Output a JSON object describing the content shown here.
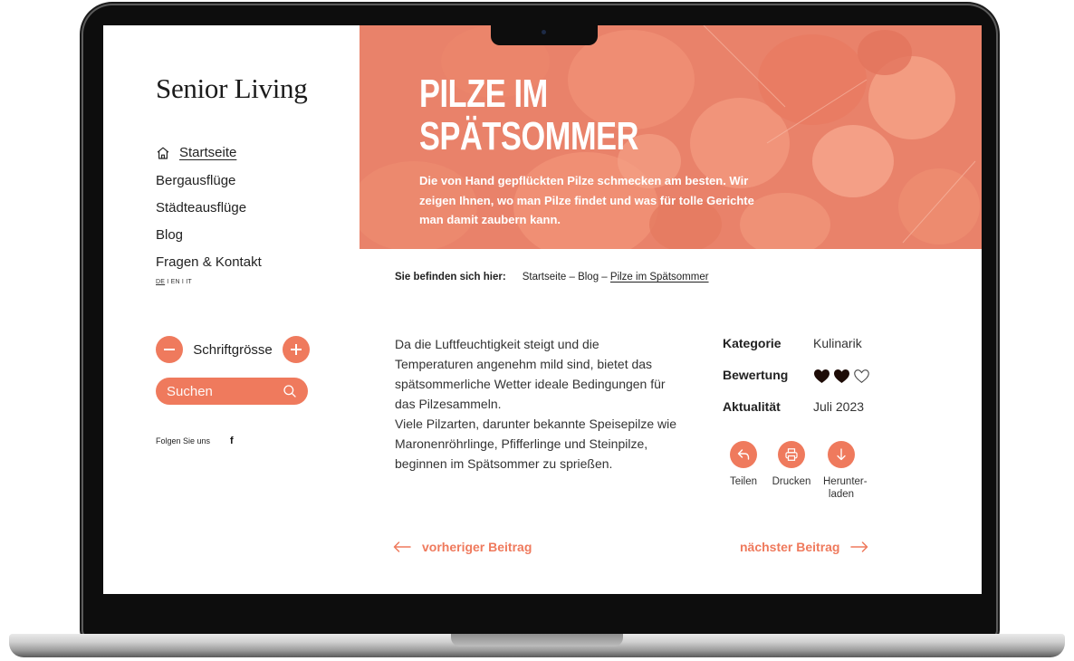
{
  "site": {
    "logo": "Senior Living"
  },
  "sidebar": {
    "nav": [
      {
        "label": "Startseite",
        "icon": "home-icon",
        "active": true
      },
      {
        "label": "Bergausflüge"
      },
      {
        "label": "Städteausflüge"
      },
      {
        "label": "Blog"
      },
      {
        "label": "Fragen & Kontakt"
      }
    ],
    "languages": [
      "DE",
      "EN",
      "IT"
    ],
    "language_separator": "I",
    "current_language": "DE",
    "font_size": {
      "label": "Schriftgrösse",
      "decrease_icon": "minus-icon",
      "increase_icon": "plus-icon"
    },
    "search": {
      "placeholder": "Suchen",
      "icon": "search-icon"
    },
    "follow": {
      "label": "Folgen Sie uns",
      "icon": "facebook-icon",
      "glyph": "f"
    }
  },
  "hero": {
    "title_lines": [
      "PILZE IM",
      "SPÄTSOMMER"
    ],
    "subtitle": "Die von Hand gepflückten Pilze schmecken am besten. Wir zeigen Ihnen, wo man Pilze findet und was für tolle Gerichte man damit zaubern kann."
  },
  "breadcrumb": {
    "label": "Sie befinden sich hier:",
    "items": [
      "Startseite",
      "Blog",
      "Pilze im Spätsommer"
    ],
    "separator": " – "
  },
  "article": {
    "paragraphs": [
      "Da die Luftfeuchtigkeit steigt und die Temperaturen angenehm mild sind, bietet das spätsommerliche Wetter ideale Bedingungen für das Pilzesammeln.",
      "Viele Pilzarten, darunter bekannte Speisepilze wie Maronenröhrlinge, Pfifferlinge und Steinpilze, beginnen im Spätsommer zu sprießen."
    ]
  },
  "meta": {
    "category_label": "Kategorie",
    "category_value": "Kulinarik",
    "rating_label": "Bewertung",
    "rating_value": 2,
    "rating_max": 3,
    "date_label": "Aktualität",
    "date_value": "Juli 2023"
  },
  "actions": [
    {
      "label": "Teilen",
      "icon": "share-icon"
    },
    {
      "label": "Drucken",
      "icon": "print-icon"
    },
    {
      "label": "Herunter-laden",
      "icon": "download-icon"
    }
  ],
  "post_nav": {
    "prev": "vorheriger Beitrag",
    "next": "nächster Beitrag"
  },
  "colors": {
    "accent": "#ef7a5d",
    "text": "#222222",
    "hero_overlay": "#e9826a"
  }
}
